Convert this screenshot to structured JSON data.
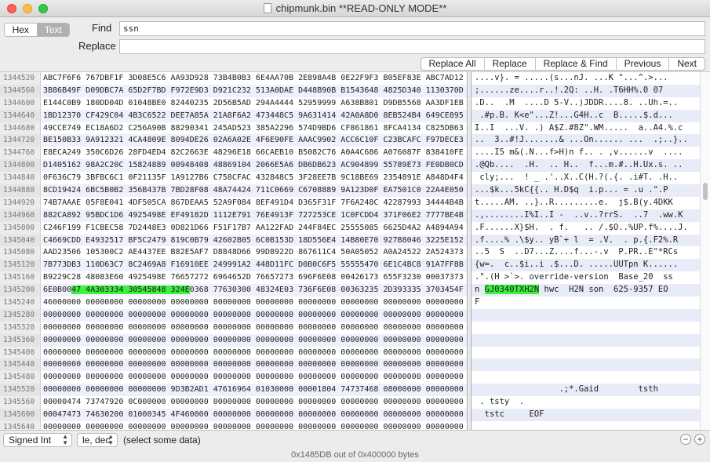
{
  "window": {
    "title": "chipmunk.bin **READ-ONLY MODE**"
  },
  "find": {
    "mode_hex": "Hex",
    "mode_text": "Text",
    "find_label": "Find",
    "find_value": "ssn",
    "replace_label": "Replace",
    "replace_value": "",
    "buttons": [
      "Replace All",
      "Replace",
      "Replace & Find",
      "Previous",
      "Next"
    ]
  },
  "rows": [
    {
      "offset": "1344520",
      "hex": "ABC7F6F6 767DBF1F 3D08E5C6 AA93D928 73B4B0B3 6E4AA70B 2E898A4B 0E22F9F3 B05EF83E ABC7AD12",
      "text": "....v}. = .....(s...nJ. ...K \"...^.>..."
    },
    {
      "offset": "1344560",
      "hex": "3B86B49F D09DBC7A 65D2F7BD F972E9D3 D921C232 513A0DAE D448B90B B1543648 4825D340 1130370D",
      "text": ";......ze....r..!.2Q: ..H. .T6HH%.0 07"
    },
    {
      "offset": "1344600",
      "hex": "E144C0B9 180DD04D 01048BE0 82440235 2D56B5AD 294A4444 52959999 A638B801 D9DB5568 AA3DF1EB",
      "text": ".D..  .M  ....D 5-V..)JDDR....8. ..Uh.=.."
    },
    {
      "offset": "1344640",
      "hex": "1BD12370 CF429C04 4B3C6522 DEE7A85A 21A8F6A2 473448C5 9A631414 42A0A8D0 8EB524B4 649CE895",
      "text": " .#p.B. K<e\"...Z!...G4H..c  B.....$.d..."
    },
    {
      "offset": "1344680",
      "hex": "49CCE749 EC18A6D2 C256A90B 88290341 245AD523 385A2296 574D9BD6 CF861861 8FCA4134 C825DB63",
      "text": "I..I  ...V. .) A$Z.#8Z\".WM.....  a..A4.%.c"
    },
    {
      "offset": "1344720",
      "hex": "BE150B33 9A912321 4CA4809E 8094DE26 02A6A02E 4F6E90FE AAAC9902 ACC6C10F C23BCAFC F97DECE3",
      "text": "..  3..#!J.......& ...On...... ...  .;..}.."
    },
    {
      "offset": "1344760",
      "hex": "E8ECA249 350C6D26 28FD4ED4 82C2663E 48296E18 66CAEB10 B5082C76 A0A4C686 A076087F 838410FE",
      "text": "....I5 m&(.N...f>H)n f.. . ,v......v  ...."
    },
    {
      "offset": "1344800",
      "hex": "D1405162 98A2C20C 15824889 00948408 48869104 2066E5A6 DB6DB623 AC904899 55789E73 FE0DB0CD",
      "text": ".@Qb....  .H.  .. H..  f...m.#..H.Ux.s. .."
    },
    {
      "offset": "1344840",
      "hex": "0F636C79 3BFBC6C1 0F21135F 1A9127B6 C758CFAC 432848C5 3F28EE7B 9C18BE69 2354891E A848D4F4",
      "text": " cly;...  ! _ .'..X..C(H.?(.{. .i#T. .H.."
    },
    {
      "offset": "1344880",
      "hex": "8CD19424 6BC5B0B2 356B437B 7BD28F08 48A74424 711C0669 C6708889 9A123D0F EA7501C0 22A4E050",
      "text": "...$k...5kC{{.. H.D$q  i.p... = .u .\".P"
    },
    {
      "offset": "1344920",
      "hex": "74B7AAAE 05F8E041 4DF505CA 867DEAA5 52A9F084 8EF491D4 D365F31F 7F6A248C 42287993 34444B4B",
      "text": "t.....AM. ..}..R.........e.  j$.B(y.4DKK"
    },
    {
      "offset": "1344960",
      "hex": "882CA892 95BDC1D6 4925498E EF49182D 1112E791 76E4913F 727253CE 1C0FCDD4 371F06E2 7777BE4B",
      "text": ".,........I%I..I -  ..v..?rrS.  ..7  .ww.K"
    },
    {
      "offset": "1345000",
      "hex": "C246F199 F1CBEC58 7D2448E3 0D821D66 F51F17B7 AA122FAD 244F84EC 25555085 6625D4A2 A4894A94",
      "text": ".F......X}$H.  . f.   .. /.$O..%UP.f%....J."
    },
    {
      "offset": "1345040",
      "hex": "C4669CDD E4932517 BF5C2479 819C0B79 42602B05 6C0B153D 18D556E4 14B80E70 927B8046 3225E152",
      "text": ".f....% .\\$y.. yB`+ l  = .V.  . p.{.F2%.R"
    },
    {
      "offset": "1345080",
      "hex": "AAD23506 105300C2 AE4437EE B82E5AF7 D8848D66 99D8922D 867611C4 50A05052 A0A24522 2A524373",
      "text": "..5  S  ..D7...Z....f...-.v  P.PR..E\"*RCs"
    },
    {
      "offset": "1345120",
      "hex": "7B773DB3 110D63C7 8C2469A8 F16910EE 249991A2 448D11FC D0B0C6F5 55555470 6E1C4BC8 91A7FF8B",
      "text": "{w=.  c..$i..i .$...D. .....UUTpn K......"
    },
    {
      "offset": "1345160",
      "hex": "B9229C28 48083E60 4925498E 76657272 6964652D 76657273 696F6E08 00426173 655F3230 00037373",
      "text": ".\".(H >`>. override-version  Base_20  ss"
    },
    {
      "offset": "1345200",
      "hex_pre": "6E0B00",
      "hex_hl": "47 4A303334 30545848 324E",
      "hex_post": "0368 77630300 48324E03 736F6E08 00363235 2D393335 3703454F",
      "text_pre": "n ",
      "text_hl": "GJ0340TXH2N",
      "text_post": " hwc  H2N son  625-9357 EO"
    },
    {
      "offset": "1345240",
      "hex": "46000000 00000000 00000000 00000000 00000000 00000000 00000000 00000000 00000000 00000000",
      "text": "F"
    },
    {
      "offset": "1345280",
      "hex": "00000000 00000000 00000000 00000000 00000000 00000000 00000000 00000000 00000000 00000000",
      "text": ""
    },
    {
      "offset": "1345320",
      "hex": "00000000 00000000 00000000 00000000 00000000 00000000 00000000 00000000 00000000 00000000",
      "text": ""
    },
    {
      "offset": "1345360",
      "hex": "00000000 00000000 00000000 00000000 00000000 00000000 00000000 00000000 00000000 00000000",
      "text": ""
    },
    {
      "offset": "1345400",
      "hex": "00000000 00000000 00000000 00000000 00000000 00000000 00000000 00000000 00000000 00000000",
      "text": ""
    },
    {
      "offset": "1345440",
      "hex": "00000000 00000000 00000000 00000000 00000000 00000000 00000000 00000000 00000000 00000000",
      "text": ""
    },
    {
      "offset": "1345480",
      "hex": "00000000 00000000 00000000 00000000 00000000 00000000 00000000 00000000 00000000 00000000",
      "text": ""
    },
    {
      "offset": "1345520",
      "hex": "00000000 00000000 00000000 9D3B2AD1 47616964 01030000 00001804 74737468 08000000 00000000",
      "text": "                 .;*.Gaid        tsth"
    },
    {
      "offset": "1345560",
      "hex": "00000474 73747920 0C000000 00000000 00000000 00000000 00000000 00000000 00000000 00000000",
      "text": " . tsty  ."
    },
    {
      "offset": "1345600",
      "hex": "00047473 74630200 01000345 4F460000 00000000 00000000 00000000 00000000 00000000 00000000",
      "text": "  tstc     EOF"
    },
    {
      "offset": "1345640",
      "hex": "00000000 00000000 00000000 00000000 00000000 00000000 00000000 00000000 00000000 00000000",
      "text": ""
    },
    {
      "offset": "1345680",
      "hex": "00000000 00000000 00000000 00000000 00000000 00000000 00000000 00000000 00000000 00000000",
      "text": ""
    },
    {
      "offset": "1345720",
      "hex": "00000000 00000000 00000000 00000000 00000000 00000000 00000000 00000000 00000000 00000000",
      "text": ""
    }
  ],
  "bottom": {
    "type_value": "Signed Int",
    "endian_value": "le, dec",
    "status": "(select some data)",
    "minus": "−",
    "plus": "+"
  },
  "footer": {
    "text": "0x1485DB out of 0x400000 bytes"
  },
  "colors": {
    "highlight": "#3cf03c",
    "row_alt": "#eef1fb"
  }
}
